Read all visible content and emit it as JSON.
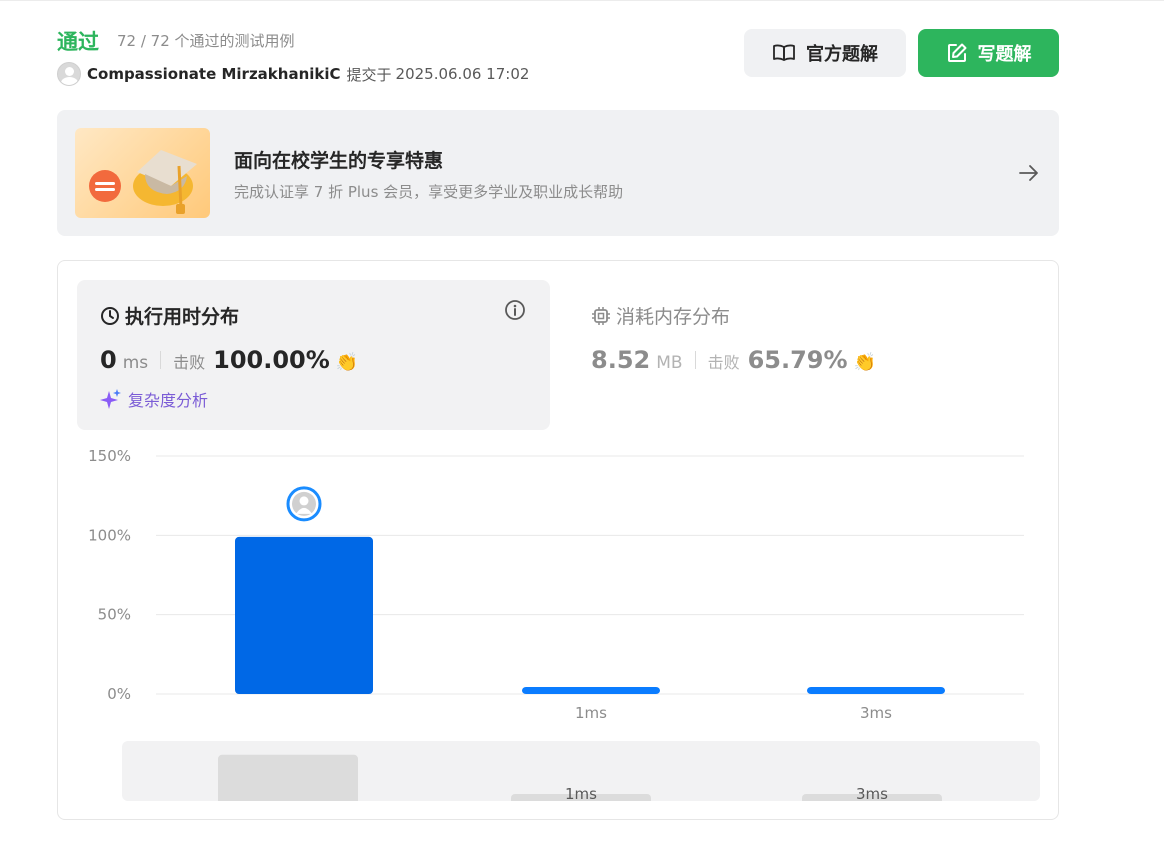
{
  "header": {
    "status": "通过",
    "cases": "72 / 72 个通过的测试用例",
    "username": "Compassionate MirzakhanikiC",
    "submit_label": "提交于",
    "submit_time": "2025.06.06 17:02",
    "official_solution_label": "官方题解",
    "write_solution_label": "写题解"
  },
  "promo": {
    "title": "面向在校学生的专享特惠",
    "subtitle": "完成认证享 7 折 Plus 会员，享受更多学业及职业成长帮助"
  },
  "runtime": {
    "title": "执行用时分布",
    "value": "0",
    "unit": "ms",
    "beat_label": "击败",
    "beat_pct": "100.00%",
    "complexity_label": "复杂度分析"
  },
  "memory": {
    "title": "消耗内存分布",
    "value": "8.52",
    "unit": "MB",
    "beat_label": "击败",
    "beat_pct": "65.79%"
  },
  "colors": {
    "accent_green": "#2db55d",
    "bar_primary": "#0068e6",
    "bar_secondary": "#0a7cff",
    "complexity_purple": "#7b5cd6"
  },
  "chart_data": {
    "type": "bar",
    "title": "",
    "categories": [
      "0ms",
      "1ms",
      "3ms"
    ],
    "tick_labels": [
      "",
      "1ms",
      "3ms"
    ],
    "values": [
      99,
      3,
      3
    ],
    "yticks": [
      "150%",
      "100%",
      "50%",
      "0%"
    ],
    "ylim": [
      0,
      150
    ],
    "grid": true,
    "highlighted_category": "0ms",
    "overview_labels": [
      "",
      "1ms",
      "3ms"
    ]
  }
}
